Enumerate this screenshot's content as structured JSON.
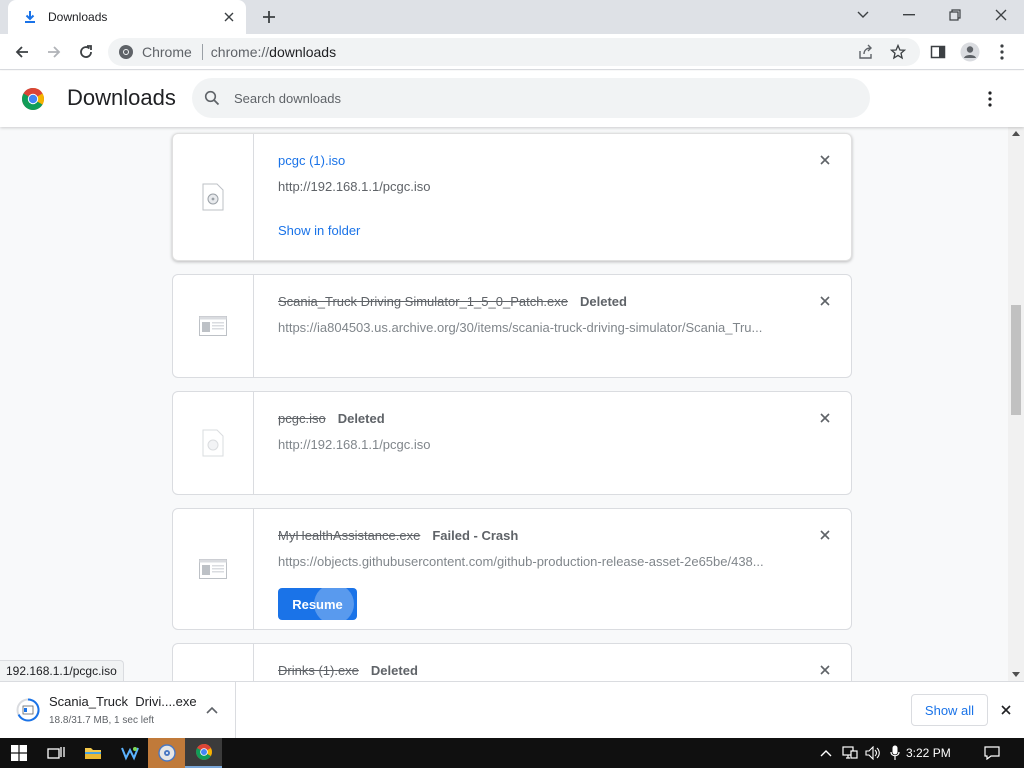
{
  "browser": {
    "tab_title": "Downloads",
    "omnibox_site": "Chrome",
    "url_scheme": "chrome://",
    "url_host": "downloads"
  },
  "header": {
    "title": "Downloads",
    "search_placeholder": "Search downloads"
  },
  "downloads": [
    {
      "name": "pcgc (1).iso",
      "status": "",
      "url": "http://192.168.1.1/pcgc.iso",
      "action": "Show in folder"
    },
    {
      "name": "Scania_Truck Driving Simulator_1_5_0_Patch.exe",
      "status": "Deleted",
      "url": "https://ia804503.us.archive.org/30/items/scania-truck-driving-simulator/Scania_Tru..."
    },
    {
      "name": "pcgc.iso",
      "status": "Deleted",
      "url": "http://192.168.1.1/pcgc.iso"
    },
    {
      "name": "MyHealthAssistance.exe",
      "status": "Failed - Crash",
      "url": "https://objects.githubusercontent.com/github-production-release-asset-2e65be/438...",
      "action": "Resume"
    },
    {
      "name": "Drinks (1).exe",
      "status": "Deleted",
      "url": ""
    }
  ],
  "status_bubble": "192.168.1.1/pcgc.iso",
  "shelf": {
    "item_name": "Scania_Truck  Drivi....exe",
    "item_progress": "18.8/31.7 MB, 1 sec left",
    "show_all": "Show all"
  },
  "taskbar": {
    "time": "3:22 PM"
  },
  "colors": {
    "accent": "#1a73e8",
    "tab_strip": "#dee1e6",
    "content_bg": "#f8f9fa"
  },
  "icons": [
    "download-icon",
    "close-icon",
    "plus-icon",
    "back-icon",
    "forward-icon",
    "reload-icon",
    "share-icon",
    "star-icon",
    "sidepanel-icon",
    "profile-icon",
    "kebab-menu-icon",
    "search-icon",
    "file-icon",
    "chevron-up-icon"
  ]
}
